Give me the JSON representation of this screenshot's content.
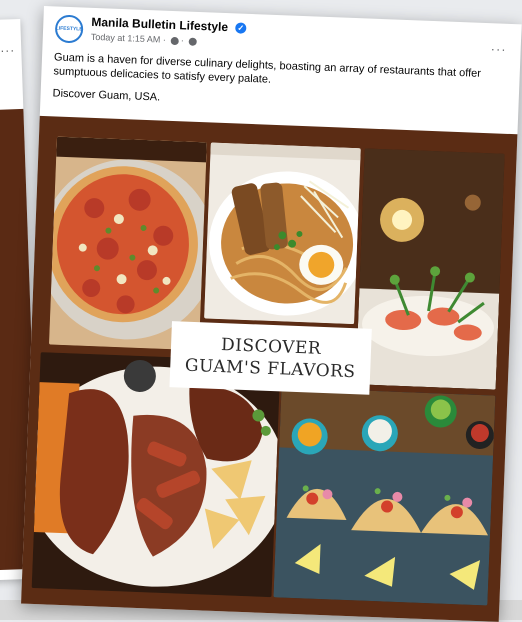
{
  "post": {
    "page_name": "Manila Bulletin Lifestyle",
    "avatar_text": "LIFESTYLE",
    "timestamp": "Today at 1:15 AM",
    "caption_line1": "Guam is a haven for diverse culinary delights, boasting an array of restaurants that offer sumptuous delicacies to satisfy every palate.",
    "caption_line2": "Discover Guam, USA.",
    "more_label": "···"
  },
  "image": {
    "banner_line1": "DISCOVER",
    "banner_line2": "GUAM'S FLAVORS",
    "dishes": [
      "pizza",
      "ramen",
      "salad",
      "grilled meats",
      "tacos"
    ]
  },
  "colors": {
    "background_brown": "#5b2c14",
    "verified_blue": "#1877f2"
  }
}
